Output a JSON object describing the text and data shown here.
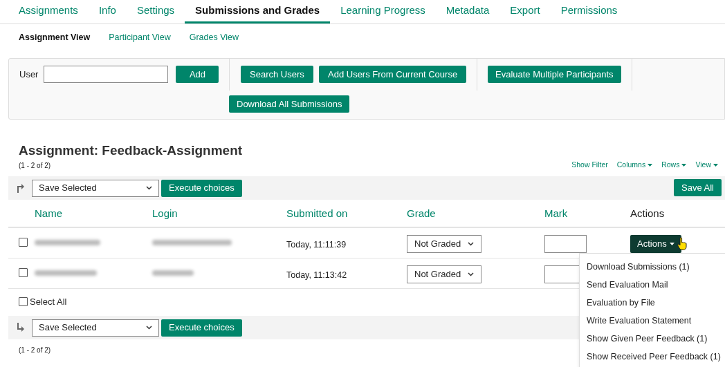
{
  "tabs": [
    {
      "label": "Assignments",
      "selected": false
    },
    {
      "label": "Info",
      "selected": false
    },
    {
      "label": "Settings",
      "selected": false
    },
    {
      "label": "Submissions and Grades",
      "selected": true
    },
    {
      "label": "Learning Progress",
      "selected": false
    },
    {
      "label": "Metadata",
      "selected": false
    },
    {
      "label": "Export",
      "selected": false
    },
    {
      "label": "Permissions",
      "selected": false
    }
  ],
  "subtabs": [
    {
      "label": "Assignment View",
      "selected": true
    },
    {
      "label": "Participant View",
      "selected": false
    },
    {
      "label": "Grades View",
      "selected": false
    }
  ],
  "toolbar": {
    "user_label": "User",
    "add": "Add",
    "search_users": "Search Users",
    "add_from_course": "Add Users From Current Course",
    "evaluate_multiple": "Evaluate Multiple Participants",
    "download_all": "Download All Submissions"
  },
  "title": "Assignment: Feedback-Assignment",
  "count_top": "(1 - 2 of 2)",
  "table_controls": [
    "Show Filter",
    "Columns",
    "Rows",
    "View"
  ],
  "top_actions": {
    "select": "Save Selected",
    "execute": "Execute choices",
    "save_all": "Save All"
  },
  "columns": [
    "Name",
    "Login",
    "Submitted on",
    "Grade",
    "Mark",
    "Actions"
  ],
  "rows": [
    {
      "checked": false,
      "submitted": "Today, 11:11:39",
      "grade": "Not Graded",
      "actions": "Actions"
    },
    {
      "checked": false,
      "submitted": "Today, 11:13:42",
      "grade": "Not Graded"
    }
  ],
  "select_all": {
    "label": "Select All",
    "checked": false
  },
  "bottom_actions": {
    "select": "Save Selected",
    "execute": "Execute choices"
  },
  "count_bottom": "(1 - 2 of 2)",
  "actions_menu": [
    "Download Submissions (1)",
    "Send Evaluation Mail",
    "Evaluation by File",
    "Write Evaluation Statement",
    "Show Given Peer Feedback (1)",
    "Show Received Peer Feedback (1)"
  ]
}
